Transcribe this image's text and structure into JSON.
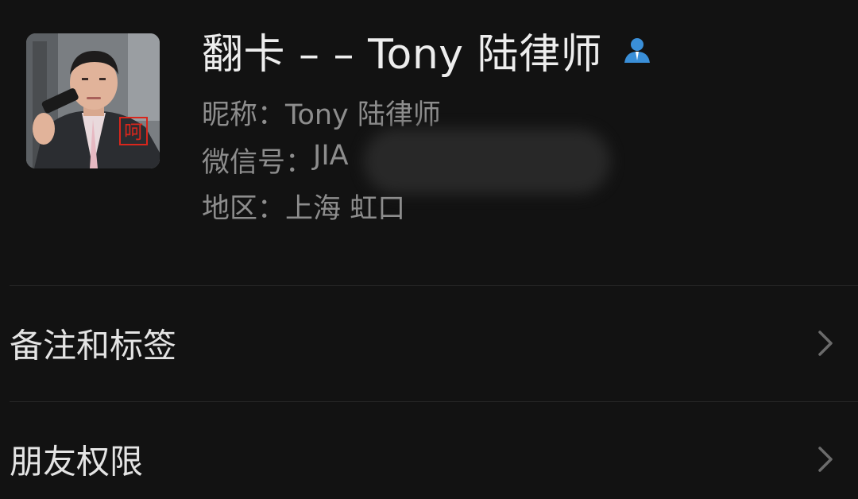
{
  "profile": {
    "display_name": "翻卡 – – Tony 陆律师",
    "verified_icon": "person-badge-icon",
    "avatar_icon": "avatar-photo",
    "avatar_caption": "呵",
    "nickname_label": "昵称：",
    "nickname": "Tony 陆律师",
    "wechat_id_label": "微信号：",
    "wechat_id": "JIA",
    "region_label": "地区：",
    "region": "上海 虹口"
  },
  "menu": {
    "items": [
      {
        "label": "备注和标签",
        "icon": "chevron-right-icon"
      },
      {
        "label": "朋友权限",
        "icon": "chevron-right-icon"
      }
    ]
  },
  "colors": {
    "background": "#121212",
    "title_text": "#ededed",
    "secondary_text": "#8d8d8d",
    "divider": "#262626",
    "verified_blue": "#3a8fd8"
  }
}
